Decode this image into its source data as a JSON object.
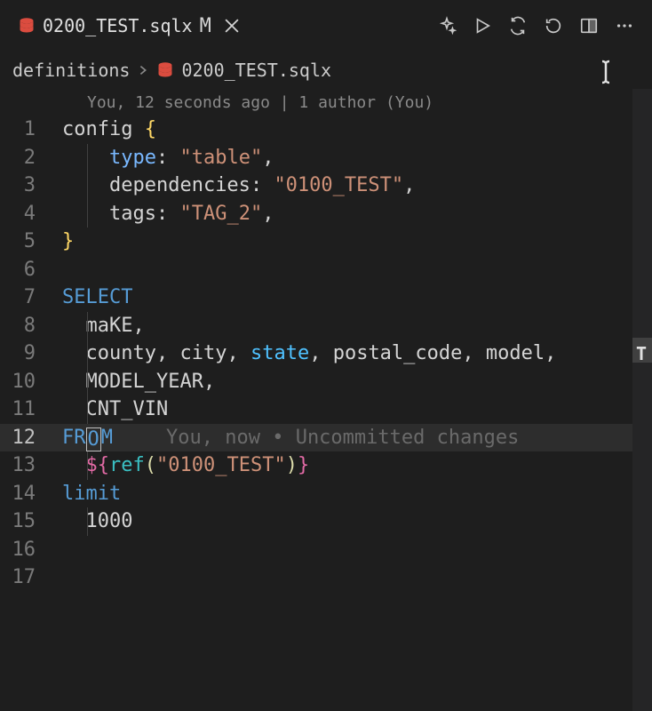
{
  "tab": {
    "filename": "0200_TEST.sqlx",
    "modified_indicator": "M"
  },
  "breadcrumb": {
    "folder": "definitions",
    "filename": "0200_TEST.sqlx"
  },
  "codelens": {
    "author_line": "You, 12 seconds ago | 1 author (You)"
  },
  "editor": {
    "lines": [
      {
        "num": "1"
      },
      {
        "num": "2"
      },
      {
        "num": "3"
      },
      {
        "num": "4"
      },
      {
        "num": "5"
      },
      {
        "num": "6"
      },
      {
        "num": "7"
      },
      {
        "num": "8"
      },
      {
        "num": "9"
      },
      {
        "num": "10"
      },
      {
        "num": "11"
      },
      {
        "num": "12"
      },
      {
        "num": "13"
      },
      {
        "num": "14"
      },
      {
        "num": "15"
      },
      {
        "num": "16"
      },
      {
        "num": "17"
      }
    ],
    "t": {
      "config": "config",
      "brace_open": "{",
      "brace_close": "}",
      "type": "type",
      "colon": ":",
      "table_str": "\"table\"",
      "comma": ",",
      "dependencies": "dependencies",
      "dep_str": "\"0100_TEST\"",
      "tags": "tags",
      "tag_str": "\"TAG_2\"",
      "select": "SELECT",
      "make": "maKE",
      "county": "county",
      "city": "city",
      "state": "state",
      "postal_code": "postal_code",
      "model": "model",
      "model_year": "MODEL_YEAR",
      "cnt_vin": "CNT_VIN",
      "from_fr": "FR",
      "from_o": "O",
      "from_m": "M",
      "inline_annotation": "You, now • Uncommitted changes",
      "dollar_open": "${",
      "ref": "ref",
      "paren_open": "(",
      "ref_str": "\"0100_TEST\"",
      "paren_close": ")",
      "dollar_close": "}",
      "limit": "limit",
      "thousand": "1000"
    }
  },
  "minimap_marker": "T"
}
